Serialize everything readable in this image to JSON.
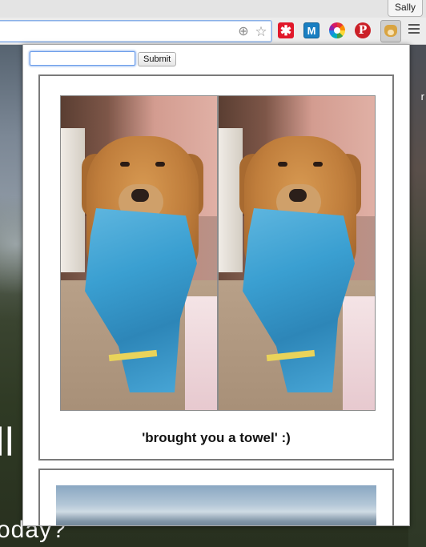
{
  "user_bar": {
    "user_name": "Sally"
  },
  "toolbar": {
    "omnibox_value": "",
    "icons": [
      "target-icon",
      "star-icon"
    ],
    "extensions": [
      {
        "name": "asterisk-extension-icon",
        "glyph": "✱",
        "color": "#e1182a"
      },
      {
        "name": "m-extension-icon",
        "glyph": "M",
        "color": "#1a7fc2"
      },
      {
        "name": "color-wheel-extension-icon",
        "glyph": "",
        "color": "#fdd835"
      },
      {
        "name": "pinterest-extension-icon",
        "glyph": "P",
        "color": "#cb2027"
      },
      {
        "name": "doge-extension-icon",
        "glyph": "",
        "color": "#d9a441"
      }
    ]
  },
  "background": {
    "title_fragment": "lll",
    "subtitle_fragment": "oday?",
    "right_fragment": "r"
  },
  "popup": {
    "input_value": "",
    "submit_label": "Submit",
    "posts": [
      {
        "caption": "'brought you a towel' :)"
      },
      {
        "caption": ""
      }
    ]
  }
}
